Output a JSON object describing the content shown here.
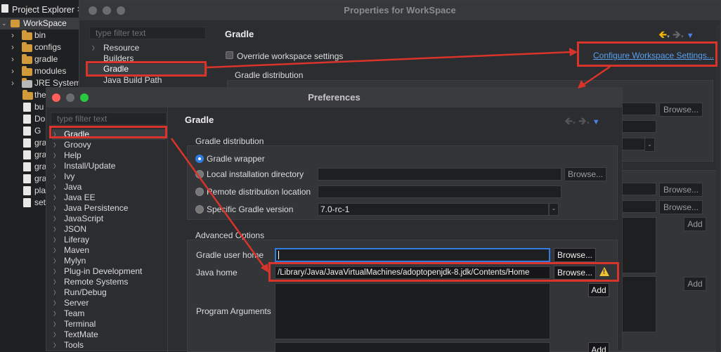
{
  "project_explorer": {
    "title": "Project Explorer",
    "close": "✕",
    "root": "WorkSpace",
    "items": [
      {
        "label": "bin",
        "type": "folder"
      },
      {
        "label": "configs",
        "type": "folder"
      },
      {
        "label": "gradle",
        "type": "folder"
      },
      {
        "label": "modules",
        "type": "folder"
      },
      {
        "label": "JRE System L",
        "type": "library"
      },
      {
        "label": "the",
        "type": "folder"
      },
      {
        "label": "bu",
        "type": "file"
      },
      {
        "label": "Do",
        "type": "file"
      },
      {
        "label": "G",
        "type": "file"
      },
      {
        "label": "gra",
        "type": "file"
      },
      {
        "label": "gra",
        "type": "file"
      },
      {
        "label": "gra",
        "type": "file"
      },
      {
        "label": "gra",
        "type": "file"
      },
      {
        "label": "pla",
        "type": "file"
      },
      {
        "label": "set",
        "type": "file"
      }
    ]
  },
  "properties": {
    "title": "Properties for WorkSpace",
    "filter_placeholder": "type filter text",
    "nav": [
      "Resource",
      "Builders",
      "Gradle",
      "Java Build Path"
    ],
    "section_title": "Gradle",
    "override_label": "Override workspace settings",
    "configure_link": "Configure Workspace Settings...",
    "distribution_label": "Gradle distribution",
    "browse": "Browse...",
    "add": "Add"
  },
  "preferences": {
    "title": "Preferences",
    "filter_placeholder": "type filter text",
    "nav": [
      "Gradle",
      "Groovy",
      "Help",
      "Install/Update",
      "Ivy",
      "Java",
      "Java EE",
      "Java Persistence",
      "JavaScript",
      "JSON",
      "Liferay",
      "Maven",
      "Mylyn",
      "Plug-in Development",
      "Remote Systems",
      "Run/Debug",
      "Server",
      "Team",
      "Terminal",
      "TextMate",
      "Tools"
    ],
    "section_title": "Gradle",
    "distribution": {
      "label": "Gradle distribution",
      "wrapper": "Gradle wrapper",
      "local": "Local installation directory",
      "remote": "Remote distribution location",
      "specific": "Specific Gradle version",
      "version": "7.0-rc-1",
      "browse": "Browse..."
    },
    "advanced": {
      "label": "Advanced Options",
      "user_home_label": "Gradle user home",
      "user_home_value": "",
      "java_home_label": "Java home",
      "java_home_value": "/Library/Java/JavaVirtualMachines/adoptopenjdk-8.jdk/Contents/Home",
      "program_args_label": "Program Arguments",
      "browse": "Browse...",
      "add": "Add"
    }
  },
  "colors": {
    "highlight": "#d9342b",
    "link": "#5aa0f0",
    "accent": "#2f7de1"
  }
}
